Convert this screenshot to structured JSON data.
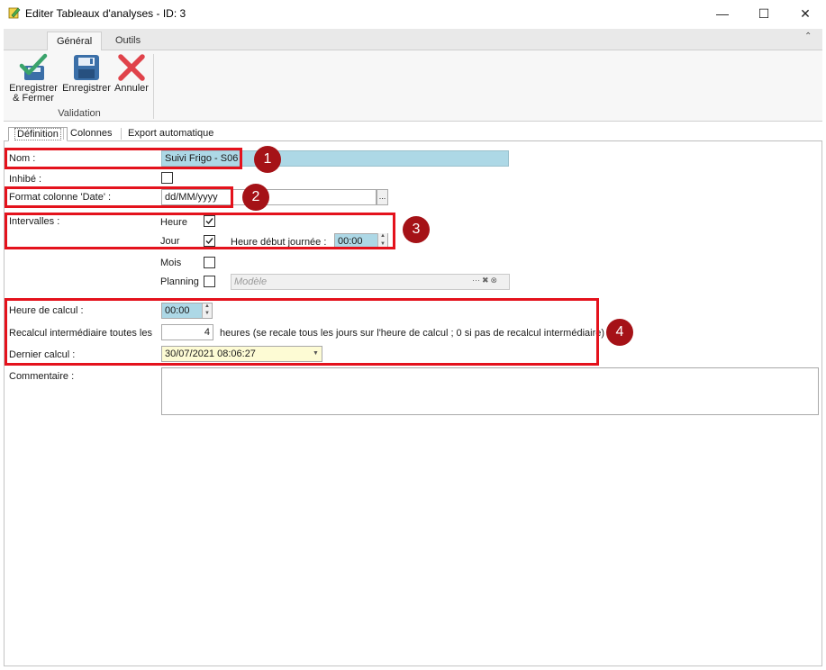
{
  "window": {
    "title": "Editer Tableaux d'analyses - ID: 3",
    "controls": {
      "minimize": "—",
      "maximize": "☐",
      "close": "✕"
    }
  },
  "ribbon": {
    "tabs": [
      "Général",
      "Outils"
    ],
    "collapse_glyph": "⌃",
    "buttons": {
      "save_close": "Enregistrer & Fermer",
      "save": "Enregistrer",
      "cancel": "Annuler"
    },
    "group_label": "Validation"
  },
  "subtabs": [
    "Définition",
    "Colonnes",
    "Export automatique"
  ],
  "form": {
    "nom_label": "Nom :",
    "nom_value": "Suivi Frigo - S06",
    "inhibe_label": "Inhibé :",
    "format_label": "Format colonne 'Date' :",
    "format_value": "dd/MM/yyyy",
    "format_btn": "...",
    "intervalles_label": "Intervalles :",
    "heure_label": "Heure",
    "jour_label": "Jour",
    "heure_debut_label": "Heure début journée :",
    "heure_debut_value": "00:00",
    "mois_label": "Mois",
    "planning_label": "Planning",
    "modele_placeholder": "Modèle",
    "heure_calcul_label": "Heure de calcul :",
    "heure_calcul_value": "00:00",
    "recalcul_label": "Recalcul intermédiaire toutes les",
    "recalcul_value": "4",
    "recalcul_suffix": "heures (se recale tous les jours sur l'heure de calcul ; 0 si pas de recalcul intermédiaire)",
    "dernier_calcul_label": "Dernier calcul :",
    "dernier_calcul_value": "30/07/2021 08:06:27",
    "commentaire_label": "Commentaire :",
    "commentaire_value": ""
  },
  "checkboxes": {
    "inhibe": false,
    "heure": true,
    "jour": true,
    "mois": false,
    "planning": false
  },
  "badges": [
    "1",
    "2",
    "3",
    "4"
  ],
  "colors": {
    "annotation_red": "#e4121c",
    "badge_bg": "#a51217",
    "nom_field_bg": "#add8e6",
    "date_field_bg": "#fdfbd4",
    "save_icon_blue": "#3b6fa8",
    "check_green": "#3aa36b",
    "cancel_red": "#e0434b"
  }
}
